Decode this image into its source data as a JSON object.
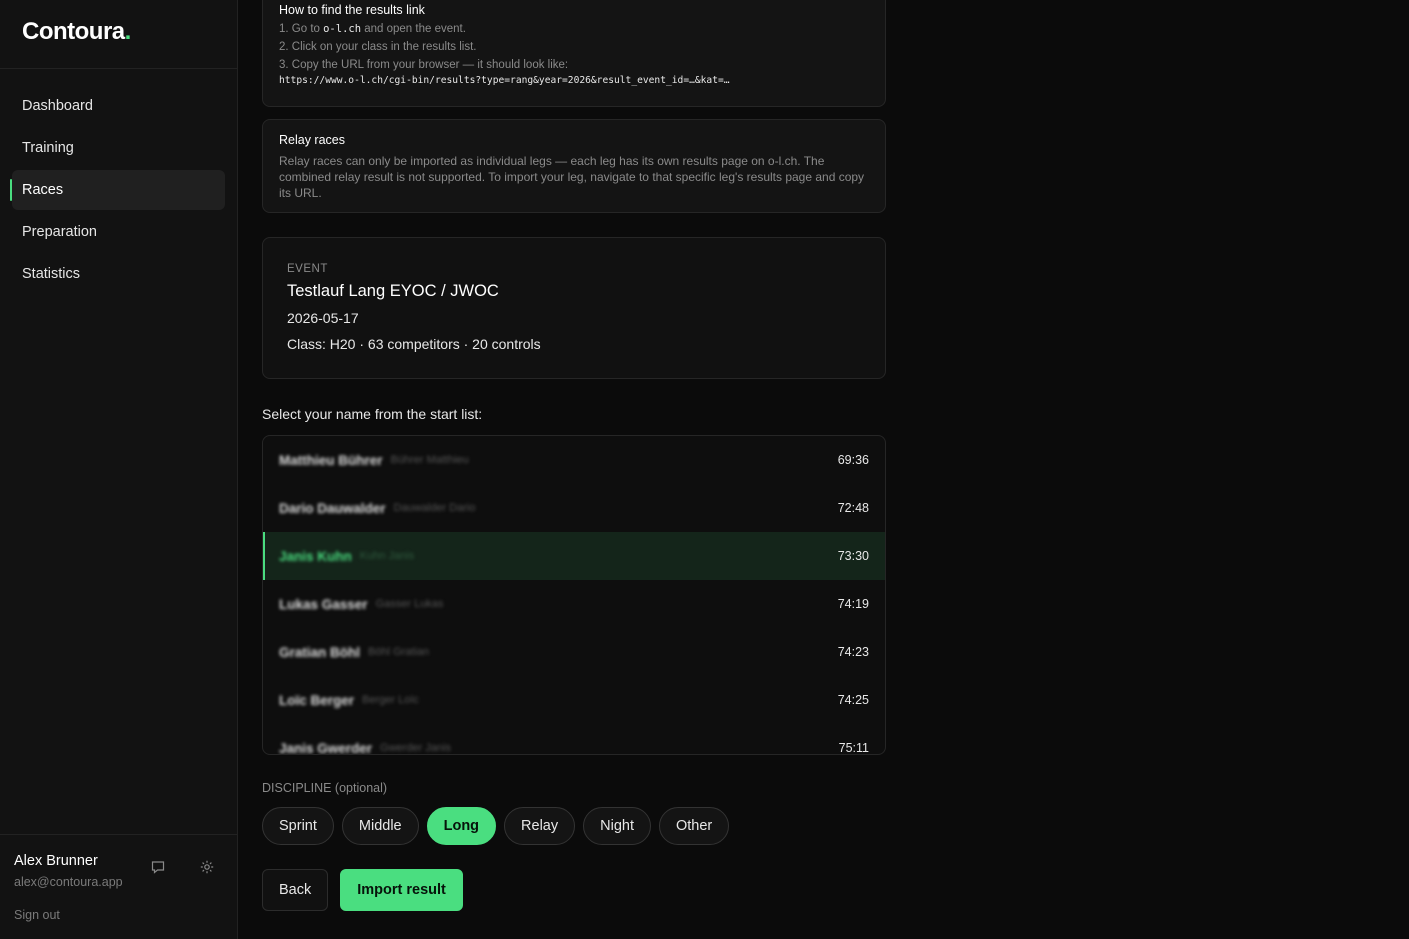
{
  "app": {
    "brand": "Contoura",
    "brand_dot": "."
  },
  "sidebar": {
    "items": [
      {
        "label": "Dashboard"
      },
      {
        "label": "Training"
      },
      {
        "label": "Races"
      },
      {
        "label": "Preparation"
      },
      {
        "label": "Statistics"
      }
    ],
    "active_index": 2,
    "user": {
      "name": "Alex Brunner",
      "email": "alex@contoura.app",
      "sign_out": "Sign out"
    },
    "icons": [
      "chat-icon",
      "gear-icon"
    ]
  },
  "howto": {
    "title": "How to find the results link",
    "step1_pre": "1. Go to ",
    "step1_code": "o-l.ch",
    "step1_post": " and open the event.",
    "step2": "2. Click on your class in the results list.",
    "step3": "3. Copy the URL from your browser — it should look like:",
    "url": "https://www.o-l.ch/cgi-bin/results?type=rang&year=2026&result_event_id=…&kat=…"
  },
  "relay": {
    "title": "Relay races",
    "text": "Relay races can only be imported as individual legs — each leg has its own results page on o-l.ch. The combined relay result is not supported. To import your leg, navigate to that specific leg's results page and copy its URL."
  },
  "event": {
    "label": "EVENT",
    "title": "Testlauf Lang EYOC / JWOC",
    "date": "2026-05-17",
    "meta": "Class: H20 · 63 competitors · 20 controls"
  },
  "startlist": {
    "label": "Select your name from the start list:",
    "rows": [
      {
        "name": "Matthieu Bührer",
        "alt": "Bührer Matthieu",
        "time": "69:36"
      },
      {
        "name": "Dario Dauwalder",
        "alt": "Dauwalder Dario",
        "time": "72:48"
      },
      {
        "name": "Janis Kuhn",
        "alt": "Kuhn Janis",
        "time": "73:30"
      },
      {
        "name": "Lukas Gasser",
        "alt": "Gasser Lukas",
        "time": "74:19"
      },
      {
        "name": "Gratian Böhl",
        "alt": "Böhl Gratian",
        "time": "74:23"
      },
      {
        "name": "Loïc Berger",
        "alt": "Berger Loïc",
        "time": "74:25"
      },
      {
        "name": "Janis Gwerder",
        "alt": "Gwerder Janis",
        "time": "75:11"
      }
    ],
    "selected_index": 2
  },
  "discipline": {
    "label": "DISCIPLINE (optional)",
    "options": [
      "Sprint",
      "Middle",
      "Long",
      "Relay",
      "Night",
      "Other"
    ],
    "selected_index": 2
  },
  "actions": {
    "back": "Back",
    "import": "Import result"
  },
  "colors": {
    "accent": "#4ade80",
    "background": "#0b0b0b",
    "sidebar": "#121212",
    "selected_row": "#14251a"
  }
}
